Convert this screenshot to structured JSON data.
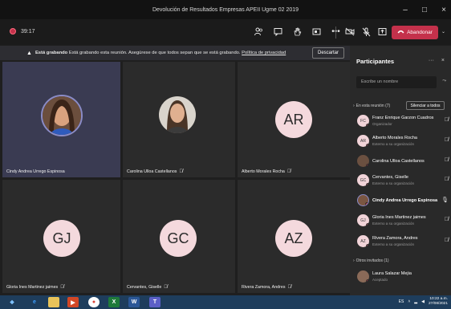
{
  "window": {
    "title": "Devolución de Resultados Empresas APEII Ugme 02 2019",
    "minimize": "–",
    "maximize": "□",
    "close": "×"
  },
  "toolbar": {
    "timer": "39:17",
    "leave_label": "Abandonar",
    "icons": [
      "participants-icon",
      "chat-icon",
      "raise-hand-icon",
      "share-tray-icon",
      "more-actions-icon",
      "camera-off-icon",
      "mic-off-icon",
      "share-screen-icon"
    ]
  },
  "banner": {
    "bold": "Está grabando",
    "text": "Está grabando esta reunión. Asegúrese de que todos sepan que se está grabando.",
    "link": "Política de privacidad",
    "dismiss": "Descartar"
  },
  "tiles": [
    {
      "name": "Cindy Andrea Urrego Espinosa",
      "kind": "photo",
      "initials": ""
    },
    {
      "name": "Carolina Ulloa Castellanos",
      "kind": "photo",
      "initials": ""
    },
    {
      "name": "Alberto Morales Rocha",
      "kind": "initials",
      "initials": "AR"
    },
    {
      "name": "Gloria Ines Martinez jaimes",
      "kind": "initials",
      "initials": "GJ"
    },
    {
      "name": "Cervantes, Giselle",
      "kind": "initials",
      "initials": "GC"
    },
    {
      "name": "Rivera Zamora, Andres",
      "kind": "initials",
      "initials": "AZ"
    }
  ],
  "panel": {
    "title": "Participantes",
    "search_placeholder": "Escribe un nombre",
    "in_meeting_label": "En esta reunión (7)",
    "mute_all": "Silenciar a todos",
    "others_label": "Otros invitados (1)",
    "people": [
      {
        "initials": "FC",
        "name": "Franz Enrique Garzon Cuadros",
        "sub": "Organizador",
        "bold": false
      },
      {
        "initials": "AR",
        "name": "Alberto Morales Rocha",
        "sub": "Externo a su organización",
        "bold": false
      },
      {
        "initials": "",
        "name": "Carolina Ulloa Castellanos",
        "sub": "",
        "bold": false
      },
      {
        "initials": "GC",
        "name": "Cervantes, Giselle",
        "sub": "Externo a su organización",
        "bold": false
      },
      {
        "initials": "",
        "name": "Cindy Andrea Urrego Espinosa",
        "sub": "",
        "bold": true
      },
      {
        "initials": "GJ",
        "name": "Gloria Ines Martinez jaimes",
        "sub": "Externo a su organización",
        "bold": false
      },
      {
        "initials": "AZ",
        "name": "Rivera Zamora, Andres",
        "sub": "Externo a su organización",
        "bold": false
      }
    ],
    "guest": {
      "initials": "",
      "name": "Laura Salazar Mejia",
      "sub": "Aceptado"
    }
  },
  "taskbar": {
    "lang": "ES",
    "time": "10:22 a.m.",
    "date": "27/08/2021"
  },
  "colors": {
    "accent_red": "#c4314b",
    "panel_bg": "#292929",
    "tile_bg": "#2b2b2b",
    "avatar_bg": "#f4d9dd"
  }
}
